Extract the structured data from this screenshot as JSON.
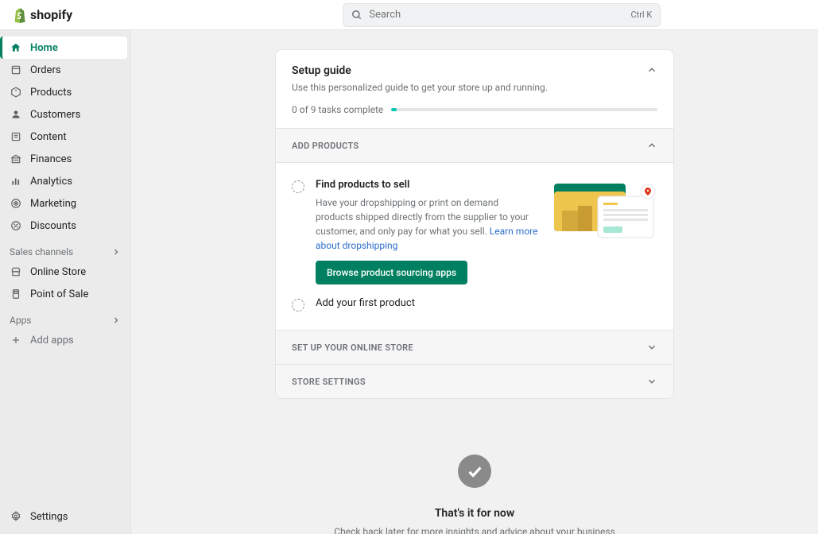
{
  "header": {
    "brand": "shopify",
    "search_placeholder": "Search",
    "search_shortcut": "Ctrl K"
  },
  "sidebar": {
    "nav": [
      {
        "label": "Home",
        "icon": "home",
        "active": true
      },
      {
        "label": "Orders",
        "icon": "orders"
      },
      {
        "label": "Products",
        "icon": "products"
      },
      {
        "label": "Customers",
        "icon": "customers"
      },
      {
        "label": "Content",
        "icon": "content"
      },
      {
        "label": "Finances",
        "icon": "finances"
      },
      {
        "label": "Analytics",
        "icon": "analytics"
      },
      {
        "label": "Marketing",
        "icon": "marketing"
      },
      {
        "label": "Discounts",
        "icon": "discounts"
      }
    ],
    "sales_channels_label": "Sales channels",
    "sales_channels": [
      {
        "label": "Online Store",
        "icon": "onlinestore"
      },
      {
        "label": "Point of Sale",
        "icon": "pos"
      }
    ],
    "apps_label": "Apps",
    "add_apps_label": "Add apps",
    "settings_label": "Settings"
  },
  "setup": {
    "title": "Setup guide",
    "subtitle": "Use this personalized guide to get your store up and running.",
    "progress_text": "0 of 9 tasks complete",
    "sections": {
      "add_products": {
        "heading": "ADD PRODUCTS",
        "expanded": true,
        "tasks": [
          {
            "title": "Find products to sell",
            "desc": "Have your dropshipping or print on demand products shipped directly from the supplier to your customer, and only pay for what you sell. ",
            "link_text": "Learn more about dropshipping",
            "cta": "Browse product sourcing apps",
            "expanded": true
          },
          {
            "title": "Add your first product",
            "expanded": false
          }
        ]
      },
      "set_up_store": {
        "heading": "SET UP YOUR ONLINE STORE",
        "expanded": false
      },
      "store_settings": {
        "heading": "STORE SETTINGS",
        "expanded": false
      }
    }
  },
  "empty": {
    "title": "That's it for now",
    "subtitle": "Check back later for more insights and advice about your business"
  }
}
